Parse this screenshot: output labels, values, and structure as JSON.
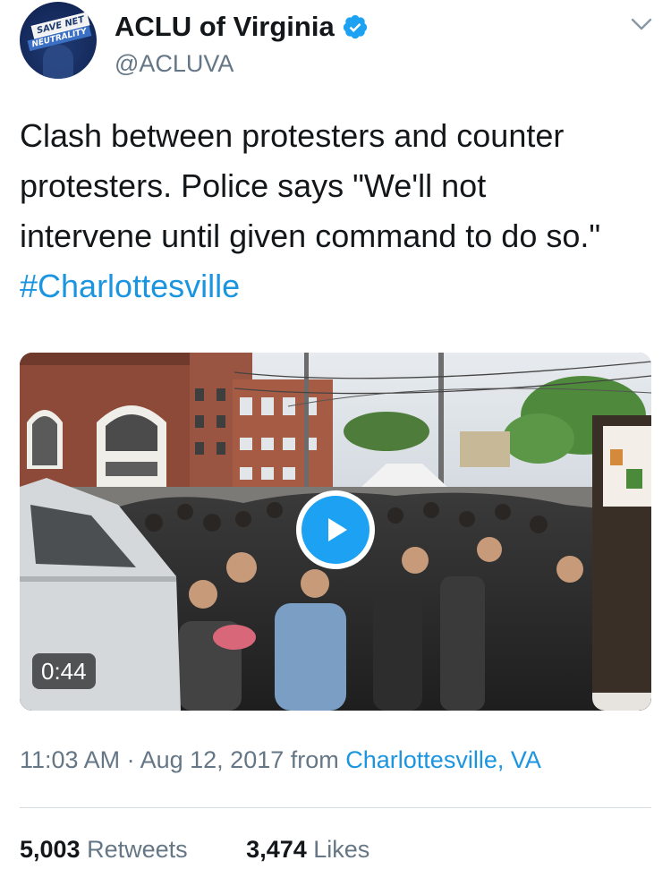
{
  "account": {
    "avatar_line1": "SAVE NET",
    "avatar_line2": "NEUTRALITY",
    "display_name": "ACLU of Virginia",
    "handle": "@ACLUVA"
  },
  "tweet": {
    "line1": "Clash between protesters and counter",
    "line2": "protesters. Police says \"We'll not",
    "line3": "intervene until given command to do so.\"",
    "hashtag": "#Charlottesville"
  },
  "media": {
    "duration": "0:44"
  },
  "meta": {
    "time": "11:03 AM",
    "separator": " · ",
    "date": "Aug 12, 2017",
    "from_label": " from ",
    "location": "Charlottesville, VA"
  },
  "stats": {
    "retweets_count": "5,003",
    "retweets_label": "Retweets",
    "likes_count": "3,474",
    "likes_label": "Likes"
  },
  "colors": {
    "link": "#1b95e0",
    "verified": "#1da1f2",
    "secondary_text": "#657786",
    "primary_text": "#14171a"
  },
  "icons": [
    "verified-badge-icon",
    "chevron-down-icon",
    "play-icon"
  ]
}
